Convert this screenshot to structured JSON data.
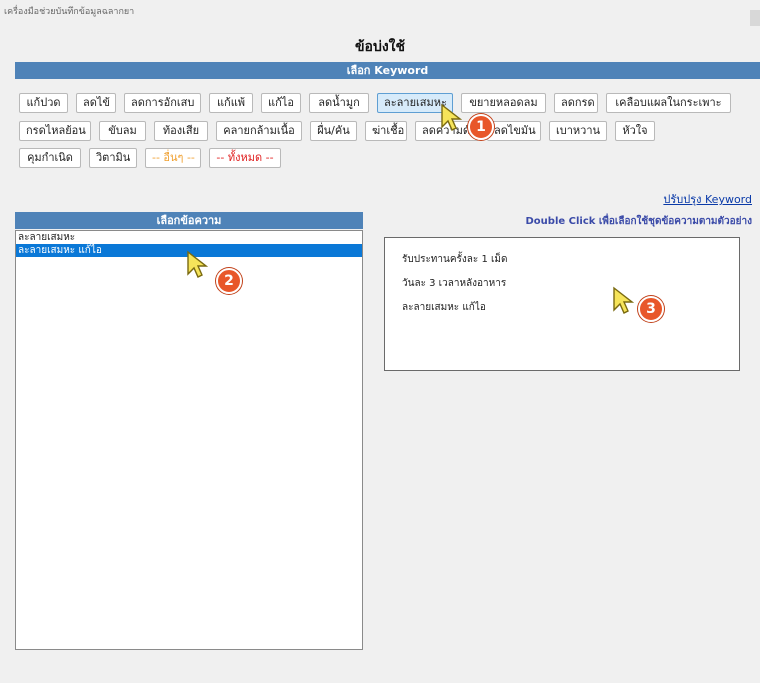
{
  "window": {
    "title": "เครื่องมือช่วยบันทึกข้อมูลฉลากยา"
  },
  "page": {
    "title": "ข้อบ่งใช้"
  },
  "keyword_section": {
    "title": "เลือก Keyword",
    "chips": [
      {
        "label": "แก้ปวด"
      },
      {
        "label": "ลดไข้"
      },
      {
        "label": "ลดการอักเสบ"
      },
      {
        "label": "แก้แพ้"
      },
      {
        "label": "แก้ไอ"
      },
      {
        "label": "ลดน้ำมูก"
      },
      {
        "label": "ละลายเสมหะ"
      },
      {
        "label": "ขยายหลอดลม"
      },
      {
        "label": "ลดกรด"
      },
      {
        "label": "เคลือบแผลในกระเพาะ"
      },
      {
        "label": "กรดไหลย้อน"
      },
      {
        "label": "ขับลม"
      },
      {
        "label": "ท้องเสีย"
      },
      {
        "label": "คลายกล้ามเนื้อ"
      },
      {
        "label": "ผื่น/คัน"
      },
      {
        "label": "ฆ่าเชื้อ"
      },
      {
        "label": "ลดความดัน"
      },
      {
        "label": "ลดไขมัน"
      },
      {
        "label": "เบาหวาน"
      },
      {
        "label": "หัวใจ"
      },
      {
        "label": "คุมกำเนิด"
      },
      {
        "label": "วิตามิน"
      },
      {
        "label": "-- อื่นๆ --"
      },
      {
        "label": "-- ทั้งหมด --"
      }
    ],
    "selected": "ละลายเสมหะ",
    "update_link": "ปรับปรุง Keyword"
  },
  "message_list": {
    "title": "เลือกข้อความ",
    "items": [
      "ละลายเสมหะ",
      "ละลายเสมหะ แก้ไอ"
    ],
    "selected_index": 1
  },
  "preview": {
    "hint": "Double Click เพื่อเลือกใช้ชุดข้อความตามตัวอย่าง",
    "lines": [
      "รับประทานครั้งละ 1 เม็ด",
      "วันละ 3 เวลาหลังอาหาร",
      "ละลายเสมหะ แก้ไอ"
    ]
  },
  "annotations": {
    "step1": "1",
    "step2": "2",
    "step3": "3"
  },
  "colors": {
    "header_bg": "#4f83b8",
    "selection": "#0a78d7",
    "badge": "#e8572a",
    "chip_active": "#d7ebfa"
  }
}
